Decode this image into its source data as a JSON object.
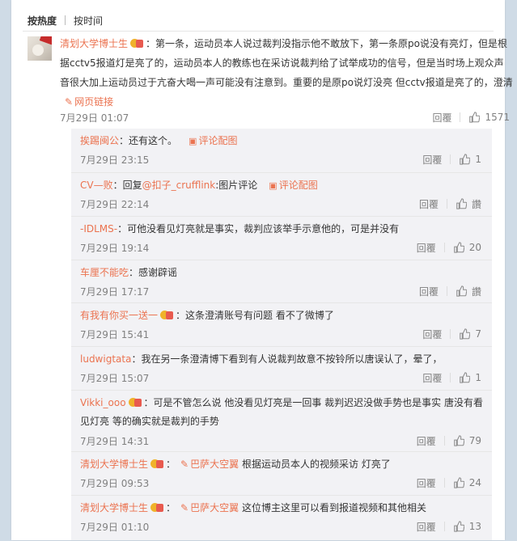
{
  "tabs": {
    "hot": "按热度",
    "time": "按时间"
  },
  "main_comment": {
    "user": "清划大学博士生",
    "text": "：第一条，运动员本人说过裁判没指示他不敢放下，第一条原po说没有亮灯，但是根据cctv5报道灯是亮了的，运动员本人的教练也在采访说裁判给了试举成功的信号，但是当时场上观众声音很大加上运动员过于亢奋大喝一声可能没有注意到。重要的是原po说灯没亮 但cctv报道是亮了的，澄清",
    "link_icon": "link-icon",
    "link": "网页链接",
    "time": "7月29日 01:07",
    "reply": "回覆",
    "likes": "1571"
  },
  "replies": [
    {
      "user": "挨踢闽公",
      "text": "：还有这个。",
      "pic_link": "评论配图",
      "time": "7月29日 23:15",
      "reply": "回覆",
      "likes": "1"
    },
    {
      "user": "CV—败",
      "text_pre": "：回复",
      "at": "@扣子_crufflink",
      "text": ":图片评论",
      "pic_link": "评论配图",
      "time": "7月29日 22:14",
      "reply": "回覆",
      "likes": "讚"
    },
    {
      "user": "-IDLMS-",
      "text": "：可他没看见灯亮就是事实，裁判应该举手示意他的，可是并没有",
      "time": "7月29日 19:14",
      "reply": "回覆",
      "likes": "20"
    },
    {
      "user": "车厘不能吃",
      "text": "：感谢辟谣",
      "time": "7月29日 17:17",
      "reply": "回覆",
      "likes": "讚"
    },
    {
      "user": "有我有你买一送一",
      "text": "：这条澄清账号有问题 看不了微博了",
      "time": "7月29日 15:41",
      "reply": "回覆",
      "likes": "7"
    },
    {
      "user": "ludwigtata",
      "text": "：我在另一条澄清博下看到有人说裁判故意不按铃所以唐误认了，晕了，",
      "time": "7月29日 15:07",
      "reply": "回覆",
      "likes": "1"
    },
    {
      "user": "Vikki_ooo",
      "text": "：可是不管怎么说  他没看见灯亮是一回事  裁判迟迟没做手势也是事实   唐没有看见灯亮  等的确实就是裁判的手势",
      "time": "7月29日 14:31",
      "reply": "回覆",
      "likes": "79"
    },
    {
      "user": "清划大学博士生",
      "link": "巴萨大空翼",
      "text": "根据运动员本人的视频采访 灯亮了",
      "time": "7月29日 09:53",
      "reply": "回覆",
      "likes": "24"
    },
    {
      "user": "清划大学博士生",
      "link": "巴萨大空翼",
      "text": "这位博主这里可以看到报道视频和其他相关",
      "time": "7月29日 01:10",
      "reply": "回覆",
      "likes": "13"
    }
  ],
  "colors": {
    "accent": "#eb7350",
    "reply_bg": "#f2f2f5",
    "page_bg": "#cfdbe6"
  }
}
